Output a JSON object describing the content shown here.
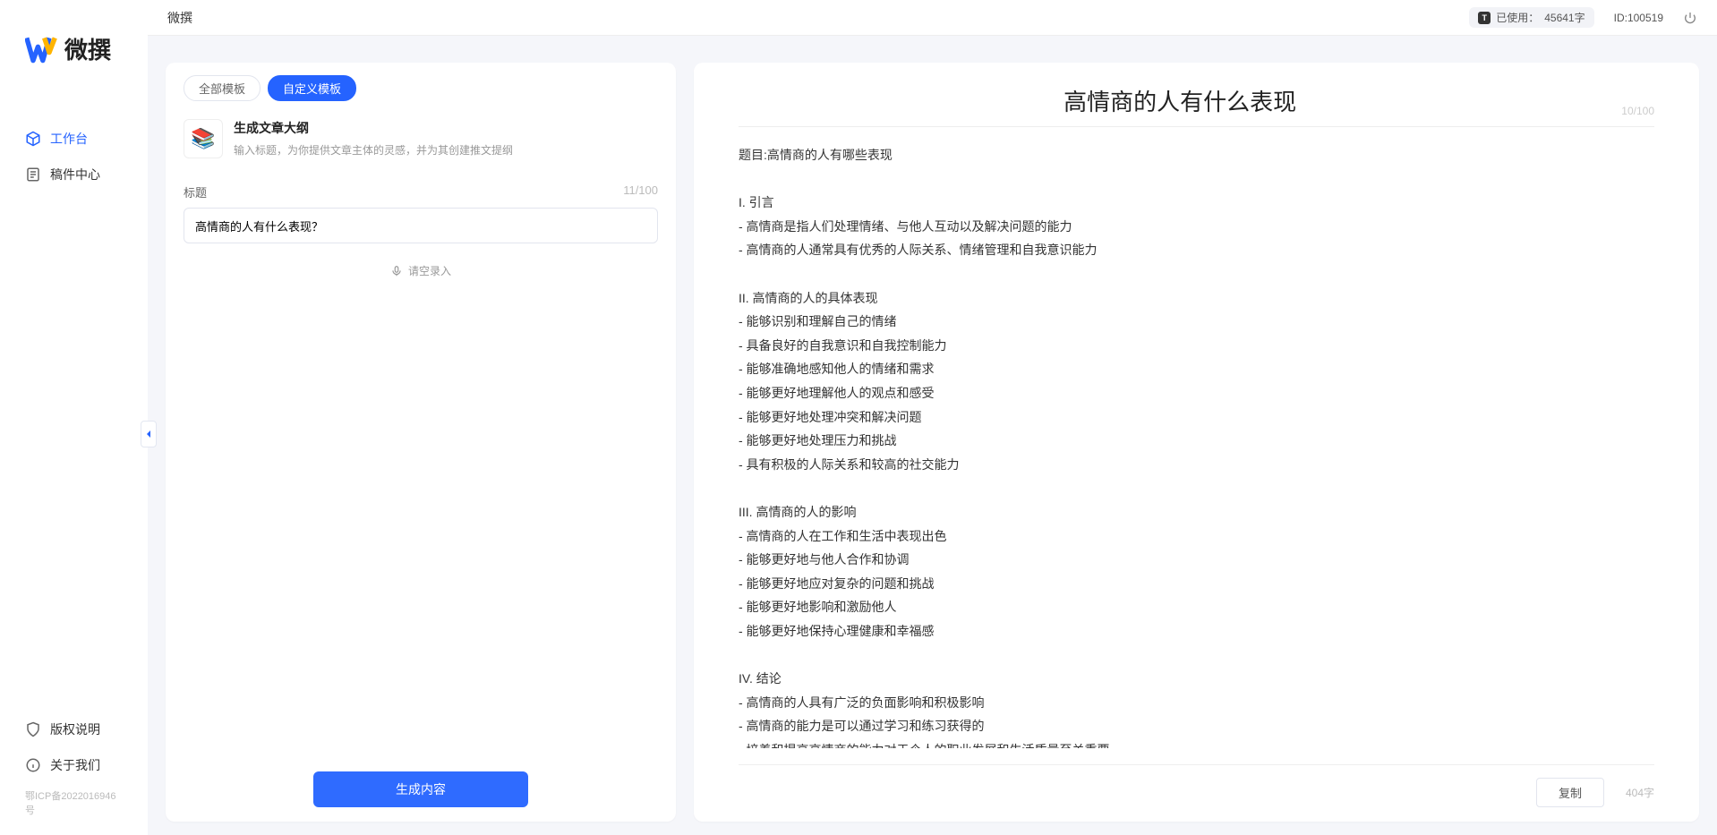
{
  "app": {
    "name": "微撰",
    "topTitle": "微撰"
  },
  "usage": {
    "label": "已使用：",
    "value": "45641字"
  },
  "userId": {
    "label": "ID:",
    "value": "100519"
  },
  "sidebar": {
    "items": [
      {
        "label": "工作台",
        "active": true
      },
      {
        "label": "稿件中心",
        "active": false
      }
    ],
    "bottom": [
      {
        "label": "版权说明"
      },
      {
        "label": "关于我们"
      }
    ],
    "icp": "鄂ICP备2022016946号"
  },
  "tabs": [
    {
      "label": "全部模板",
      "active": false
    },
    {
      "label": "自定义模板",
      "active": true
    }
  ],
  "template": {
    "title": "生成文章大纲",
    "desc": "输入标题，为你提供文章主体的灵感，并为其创建推文提纲"
  },
  "titleField": {
    "label": "标题",
    "counter": "11/100",
    "value": "高情商的人有什么表现？"
  },
  "voicePrompt": "请空录入",
  "generateLabel": "生成内容",
  "result": {
    "title": "高情商的人有什么表现",
    "titleCounter": "10/100",
    "body": "题目:高情商的人有哪些表现\n\nI. 引言\n- 高情商是指人们处理情绪、与他人互动以及解决问题的能力\n- 高情商的人通常具有优秀的人际关系、情绪管理和自我意识能力\n\nII. 高情商的人的具体表现\n- 能够识别和理解自己的情绪\n- 具备良好的自我意识和自我控制能力\n- 能够准确地感知他人的情绪和需求\n- 能够更好地理解他人的观点和感受\n- 能够更好地处理冲突和解决问题\n- 能够更好地处理压力和挑战\n- 具有积极的人际关系和较高的社交能力\n\nIII. 高情商的人的影响\n- 高情商的人在工作和生活中表现出色\n- 能够更好地与他人合作和协调\n- 能够更好地应对复杂的问题和挑战\n- 能够更好地影响和激励他人\n- 能够更好地保持心理健康和幸福感\n\nIV. 结论\n- 高情商的人具有广泛的负面影响和积极影响\n- 高情商的能力是可以通过学习和练习获得的\n- 培养和提高高情商的能力对于个人的职业发展和生活质量至关重要。",
    "copyLabel": "复制",
    "wordCount": "404字"
  }
}
